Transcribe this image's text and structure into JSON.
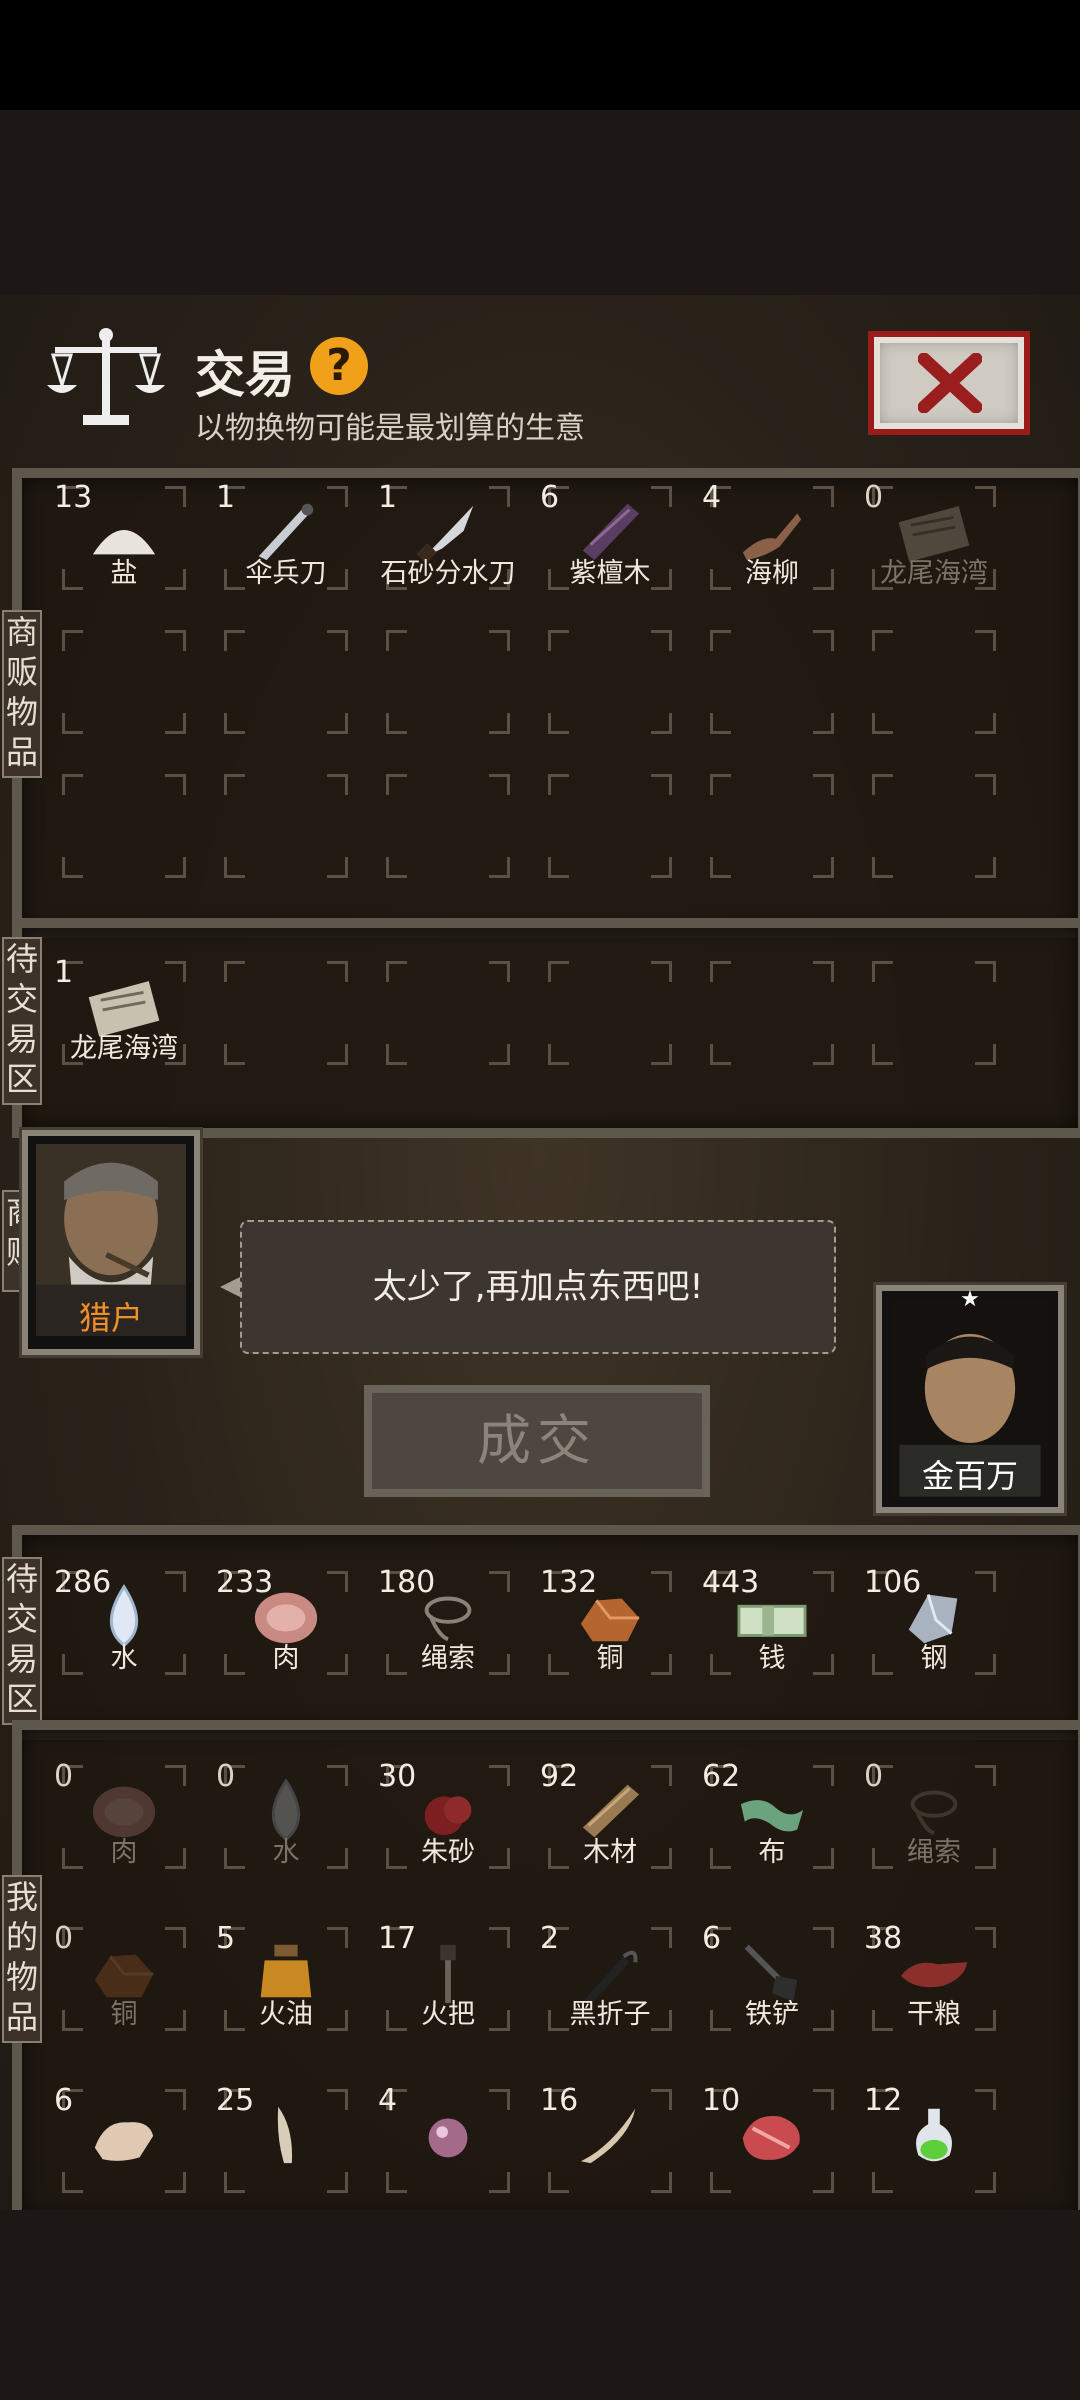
{
  "header": {
    "title": "交易",
    "help_icon": "?",
    "subtitle": "以物换物可能是最划算的生意"
  },
  "tabs": {
    "vendor_items": "商贩物品",
    "vendor_pending": "待交易区",
    "vendor": "商贩",
    "my_pending": "待交易区",
    "my_items": "我的物品"
  },
  "vendor_items": [
    {
      "count": "13",
      "name": "盐",
      "icon": "salt-icon"
    },
    {
      "count": "1",
      "name": "伞兵刀",
      "icon": "paratrooper-knife-icon"
    },
    {
      "count": "1",
      "name": "石砂分水刀",
      "icon": "knife-icon"
    },
    {
      "count": "6",
      "name": "紫檀木",
      "icon": "rosewood-icon"
    },
    {
      "count": "4",
      "name": "海柳",
      "icon": "sea-willow-icon"
    },
    {
      "count": "0",
      "name": "龙尾海湾",
      "icon": "map-icon",
      "dim": true
    }
  ],
  "vendor_pending": [
    {
      "count": "1",
      "name": "龙尾海湾",
      "icon": "map-icon"
    }
  ],
  "vendor_person": {
    "name": "猎户",
    "speech": "太少了,再加点东西吧!"
  },
  "deal_button": "成交",
  "player": {
    "name": "金百万",
    "star": "★"
  },
  "my_pending": [
    {
      "count": "286",
      "name": "水",
      "icon": "water-drop-icon"
    },
    {
      "count": "233",
      "name": "肉",
      "icon": "meat-icon"
    },
    {
      "count": "180",
      "name": "绳索",
      "icon": "rope-icon"
    },
    {
      "count": "132",
      "name": "铜",
      "icon": "copper-icon"
    },
    {
      "count": "443",
      "name": "钱",
      "icon": "money-icon"
    },
    {
      "count": "106",
      "name": "钢",
      "icon": "steel-icon"
    }
  ],
  "my_items": [
    {
      "count": "0",
      "name": "肉",
      "icon": "meat-icon",
      "dim": true
    },
    {
      "count": "0",
      "name": "水",
      "icon": "water-drop-icon",
      "dim": true
    },
    {
      "count": "30",
      "name": "朱砂",
      "icon": "cinnabar-icon"
    },
    {
      "count": "92",
      "name": "木材",
      "icon": "wood-icon"
    },
    {
      "count": "62",
      "name": "布",
      "icon": "cloth-icon"
    },
    {
      "count": "0",
      "name": "绳索",
      "icon": "rope-icon",
      "dim": true
    },
    {
      "count": "0",
      "name": "铜",
      "icon": "copper-icon",
      "dim": true
    },
    {
      "count": "5",
      "name": "火油",
      "icon": "kerosene-icon"
    },
    {
      "count": "17",
      "name": "火把",
      "icon": "torch-icon"
    },
    {
      "count": "2",
      "name": "黑折子",
      "icon": "fire-starter-icon"
    },
    {
      "count": "6",
      "name": "铁铲",
      "icon": "shovel-icon"
    },
    {
      "count": "38",
      "name": "干粮",
      "icon": "dry-food-icon"
    },
    {
      "count": "6",
      "name": "",
      "icon": "bone-icon"
    },
    {
      "count": "25",
      "name": "",
      "icon": "tooth-icon"
    },
    {
      "count": "4",
      "name": "",
      "icon": "pearl-icon"
    },
    {
      "count": "16",
      "name": "",
      "icon": "fang-icon"
    },
    {
      "count": "10",
      "name": "",
      "icon": "raw-meat-icon"
    },
    {
      "count": "12",
      "name": "",
      "icon": "potion-icon"
    }
  ],
  "colors": {
    "vendor_name": "#f0902a",
    "player_name": "#ffffff",
    "close_border": "#9b1b1b",
    "help_badge": "#f0a019"
  }
}
